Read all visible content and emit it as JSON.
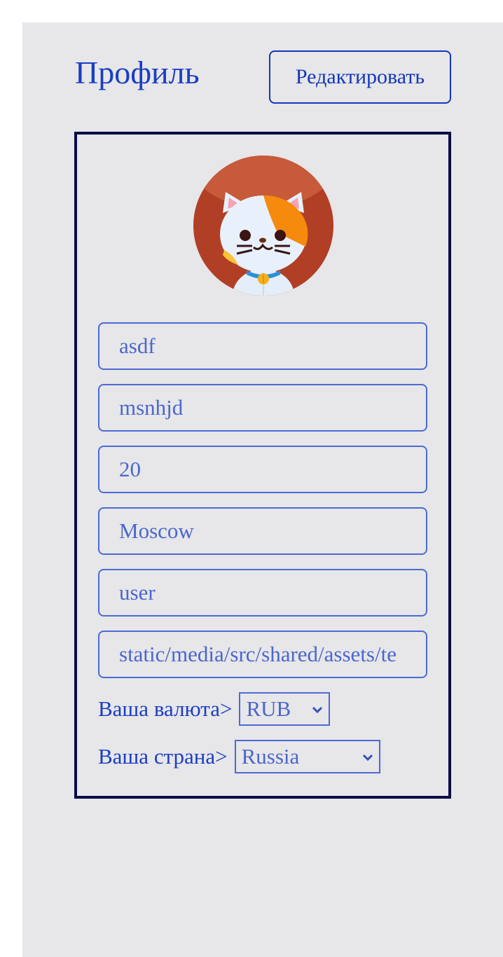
{
  "header": {
    "title": "Профиль",
    "edit_label": "Редактировать"
  },
  "profile": {
    "avatar": "cat-avatar-icon",
    "fields": [
      {
        "name": "first-name-field",
        "value": "asdf"
      },
      {
        "name": "last-name-field",
        "value": "msnhjd"
      },
      {
        "name": "age-field",
        "value": "20"
      },
      {
        "name": "city-field",
        "value": "Moscow"
      },
      {
        "name": "role-field",
        "value": "user"
      },
      {
        "name": "avatar-path-field",
        "value": "static/media/src/shared/assets/te"
      }
    ],
    "currency": {
      "label": "Ваша валюта>",
      "selected": "RUB"
    },
    "country": {
      "label": "Ваша страна>",
      "selected": "Russia"
    }
  },
  "colors": {
    "background": "#e7e6e9",
    "accent": "#1a3ec4",
    "field_border": "#4a6bd4",
    "card_border": "#0d0b45",
    "avatar_bg": "#b13f26"
  }
}
